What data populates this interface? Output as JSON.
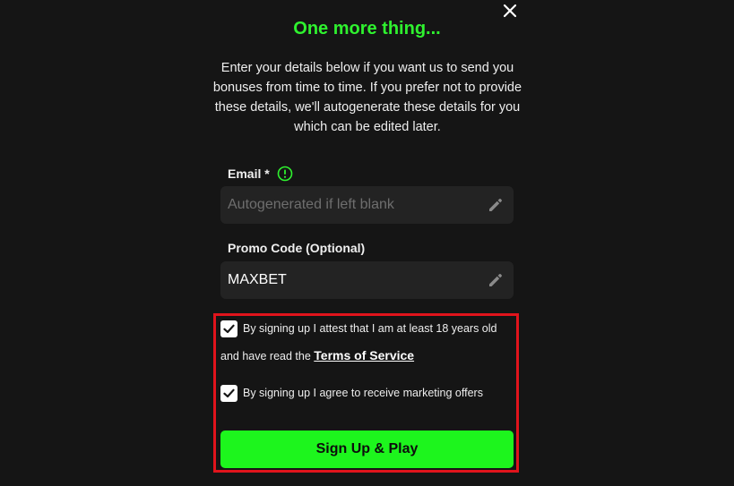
{
  "dialog": {
    "title": "One more thing...",
    "description": "Enter your details below if you want us to send you bonuses from time to time. If you prefer not to provide these details, we'll autogenerate these details for you which can be edited later.",
    "close_icon": "close-icon"
  },
  "email": {
    "label": "Email *",
    "placeholder": "Autogenerated if left blank",
    "value": "",
    "info_icon": "info-circle-icon",
    "edit_icon": "pencil-icon"
  },
  "promo": {
    "label": "Promo Code (Optional)",
    "value": "MAXBET",
    "edit_icon": "pencil-icon"
  },
  "consent": {
    "age": {
      "checked": true,
      "text_line1": "By signing up I attest that I am at least 18 years old",
      "text_line2": "and have read the",
      "link_text": "Terms of Service"
    },
    "marketing": {
      "checked": true,
      "text": "By signing up I agree to receive marketing offers"
    },
    "highlight_color": "#e0141c"
  },
  "submit": {
    "label": "Sign Up & Play"
  },
  "colors": {
    "accent": "#2ff22f",
    "button": "#1df51d",
    "background": "#151515",
    "field": "#232323"
  }
}
